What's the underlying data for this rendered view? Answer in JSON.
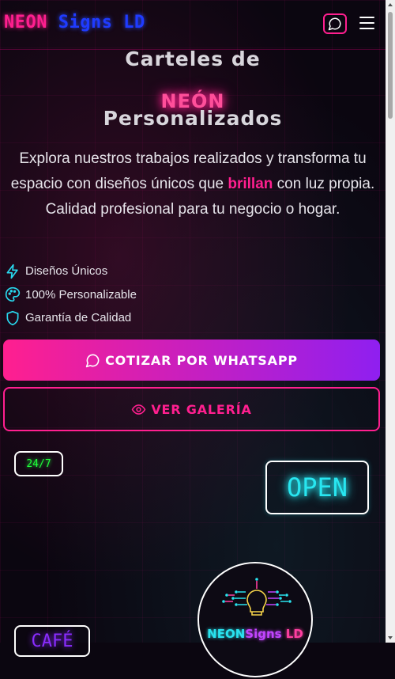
{
  "header": {
    "logo_part1": "NEON",
    "logo_part2": "Signs LD",
    "chat_icon": "whatsapp-chat-icon",
    "menu_icon": "hamburger-menu-icon"
  },
  "hero": {
    "title_line1": "Carteles de",
    "title_line2": "NEÓN",
    "title_line3": "Personalizados",
    "desc_before": "Explora nuestros trabajos realizados y transforma tu espacio con diseños únicos que ",
    "desc_highlight": "brillan",
    "desc_after": " con luz propia. Calidad profesional para tu negocio o hogar."
  },
  "features": [
    {
      "icon": "lightning-icon",
      "label": "Diseños Únicos"
    },
    {
      "icon": "palette-icon",
      "label": "100% Personalizable"
    },
    {
      "icon": "shield-icon",
      "label": "Garantía de Calidad"
    }
  ],
  "buttons": {
    "quote_label": "COTIZAR POR WHATSAPP",
    "gallery_label": "VER GALERÍA"
  },
  "signs": {
    "sign_247": "24/7",
    "sign_open": "OPEN",
    "sign_cafe": "CAFÉ"
  },
  "circle_logo": {
    "part1": "NEON",
    "part2": "Signs",
    "part3": " LD"
  },
  "colors": {
    "accent_pink": "#ff1f8f",
    "accent_purple": "#8f1ff0",
    "neon_cyan": "#28e6f0",
    "neon_green": "#1eff3a",
    "neon_blue": "#1f3bff"
  }
}
